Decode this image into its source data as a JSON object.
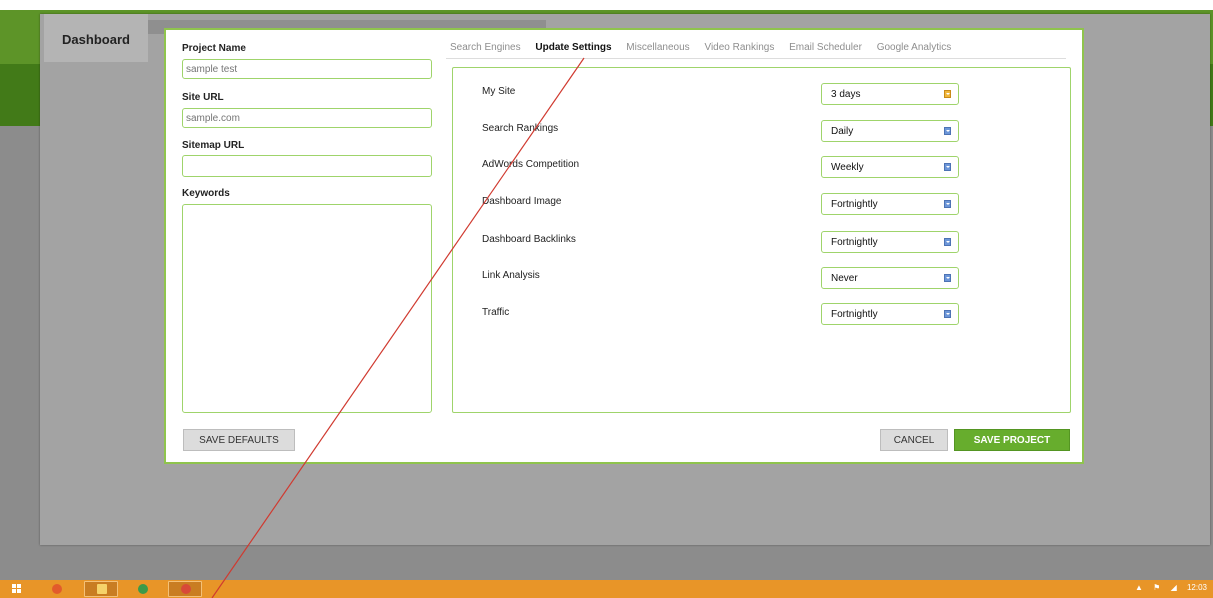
{
  "app": {
    "dashboard_tab": "Dashboard"
  },
  "form": {
    "project_name_label": "Project Name",
    "project_name_placeholder": "sample test",
    "site_url_label": "Site URL",
    "site_url_placeholder": "sample.com",
    "sitemap_url_label": "Sitemap URL",
    "sitemap_url_value": "",
    "keywords_label": "Keywords",
    "keywords_value": ""
  },
  "tabs": [
    {
      "label": "Search Engines",
      "active": false
    },
    {
      "label": "Update Settings",
      "active": true
    },
    {
      "label": "Miscellaneous",
      "active": false
    },
    {
      "label": "Video Rankings",
      "active": false
    },
    {
      "label": "Email Scheduler",
      "active": false
    },
    {
      "label": "Google Analytics",
      "active": false
    }
  ],
  "settings": [
    {
      "label": "My Site",
      "value": "3 days"
    },
    {
      "label": "Search Rankings",
      "value": "Daily"
    },
    {
      "label": "AdWords Competition",
      "value": "Weekly"
    },
    {
      "label": "Dashboard Image",
      "value": "Fortnightly"
    },
    {
      "label": "Dashboard Backlinks",
      "value": "Fortnightly"
    },
    {
      "label": "Link Analysis",
      "value": "Never"
    },
    {
      "label": "Traffic",
      "value": "Fortnightly"
    }
  ],
  "buttons": {
    "save_defaults": "SAVE DEFAULTS",
    "cancel": "CANCEL",
    "save_project": "SAVE PROJECT"
  },
  "colors": {
    "accent_green": "#67ad2d",
    "border_green": "#9fd46b",
    "annotation_red": "#d03a30",
    "taskbar": "#e89528"
  },
  "taskbar": {
    "icons": [
      "windows-start-icon",
      "firefox-icon",
      "file-explorer-icon",
      "chrome-icon",
      "chrome-icon"
    ],
    "clock": "12:03"
  }
}
